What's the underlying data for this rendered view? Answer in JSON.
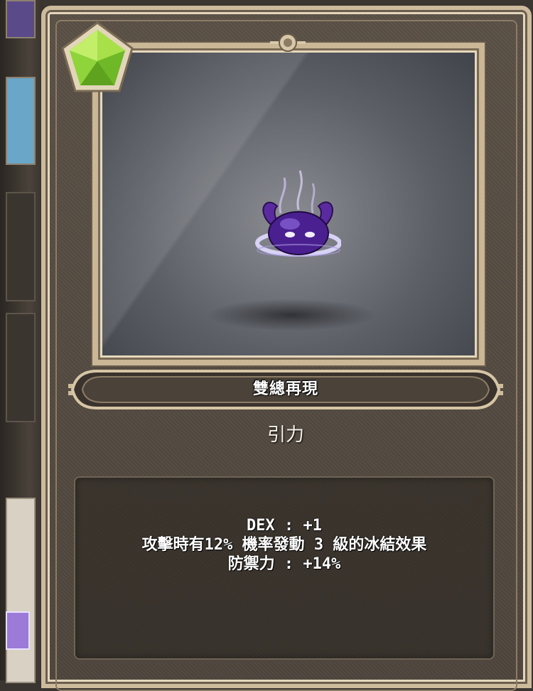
{
  "item": {
    "name": "雙總再現",
    "type": "引力",
    "stats": [
      "DEX : +1",
      "攻擊時有12% 機率發動 3 級的冰結效果",
      "防禦力 : +14%"
    ],
    "rank_gem_color": "#8fd43a",
    "art_icon": "purple-slime-crown-icon"
  },
  "colors": {
    "card_border": "#cdbb9c",
    "card_background": "#544b41",
    "text": "#ffffff"
  }
}
